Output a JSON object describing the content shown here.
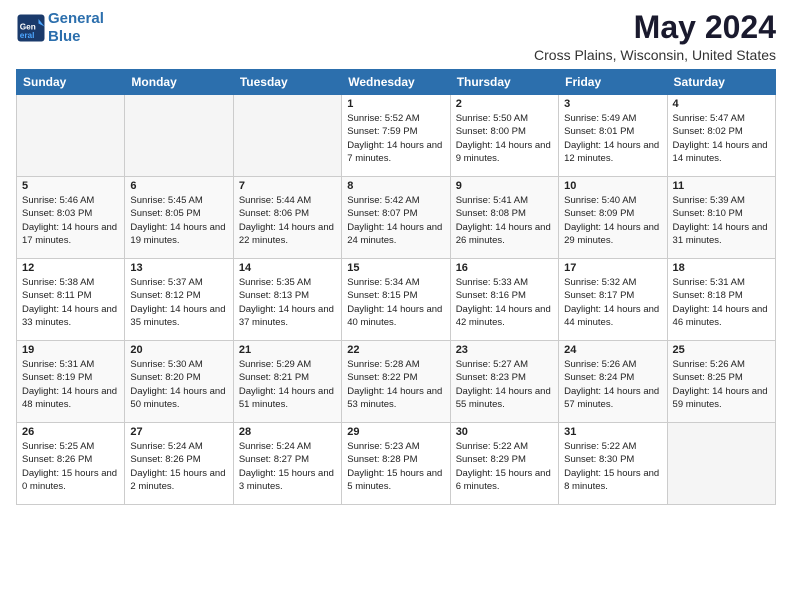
{
  "header": {
    "logo_line1": "General",
    "logo_line2": "Blue",
    "month_year": "May 2024",
    "location": "Cross Plains, Wisconsin, United States"
  },
  "weekdays": [
    "Sunday",
    "Monday",
    "Tuesday",
    "Wednesday",
    "Thursday",
    "Friday",
    "Saturday"
  ],
  "weeks": [
    [
      {
        "day": "",
        "empty": true
      },
      {
        "day": "",
        "empty": true
      },
      {
        "day": "",
        "empty": true
      },
      {
        "day": "1",
        "sunrise": "5:52 AM",
        "sunset": "7:59 PM",
        "daylight": "14 hours and 7 minutes."
      },
      {
        "day": "2",
        "sunrise": "5:50 AM",
        "sunset": "8:00 PM",
        "daylight": "14 hours and 9 minutes."
      },
      {
        "day": "3",
        "sunrise": "5:49 AM",
        "sunset": "8:01 PM",
        "daylight": "14 hours and 12 minutes."
      },
      {
        "day": "4",
        "sunrise": "5:47 AM",
        "sunset": "8:02 PM",
        "daylight": "14 hours and 14 minutes."
      }
    ],
    [
      {
        "day": "5",
        "sunrise": "5:46 AM",
        "sunset": "8:03 PM",
        "daylight": "14 hours and 17 minutes."
      },
      {
        "day": "6",
        "sunrise": "5:45 AM",
        "sunset": "8:05 PM",
        "daylight": "14 hours and 19 minutes."
      },
      {
        "day": "7",
        "sunrise": "5:44 AM",
        "sunset": "8:06 PM",
        "daylight": "14 hours and 22 minutes."
      },
      {
        "day": "8",
        "sunrise": "5:42 AM",
        "sunset": "8:07 PM",
        "daylight": "14 hours and 24 minutes."
      },
      {
        "day": "9",
        "sunrise": "5:41 AM",
        "sunset": "8:08 PM",
        "daylight": "14 hours and 26 minutes."
      },
      {
        "day": "10",
        "sunrise": "5:40 AM",
        "sunset": "8:09 PM",
        "daylight": "14 hours and 29 minutes."
      },
      {
        "day": "11",
        "sunrise": "5:39 AM",
        "sunset": "8:10 PM",
        "daylight": "14 hours and 31 minutes."
      }
    ],
    [
      {
        "day": "12",
        "sunrise": "5:38 AM",
        "sunset": "8:11 PM",
        "daylight": "14 hours and 33 minutes."
      },
      {
        "day": "13",
        "sunrise": "5:37 AM",
        "sunset": "8:12 PM",
        "daylight": "14 hours and 35 minutes."
      },
      {
        "day": "14",
        "sunrise": "5:35 AM",
        "sunset": "8:13 PM",
        "daylight": "14 hours and 37 minutes."
      },
      {
        "day": "15",
        "sunrise": "5:34 AM",
        "sunset": "8:15 PM",
        "daylight": "14 hours and 40 minutes."
      },
      {
        "day": "16",
        "sunrise": "5:33 AM",
        "sunset": "8:16 PM",
        "daylight": "14 hours and 42 minutes."
      },
      {
        "day": "17",
        "sunrise": "5:32 AM",
        "sunset": "8:17 PM",
        "daylight": "14 hours and 44 minutes."
      },
      {
        "day": "18",
        "sunrise": "5:31 AM",
        "sunset": "8:18 PM",
        "daylight": "14 hours and 46 minutes."
      }
    ],
    [
      {
        "day": "19",
        "sunrise": "5:31 AM",
        "sunset": "8:19 PM",
        "daylight": "14 hours and 48 minutes."
      },
      {
        "day": "20",
        "sunrise": "5:30 AM",
        "sunset": "8:20 PM",
        "daylight": "14 hours and 50 minutes."
      },
      {
        "day": "21",
        "sunrise": "5:29 AM",
        "sunset": "8:21 PM",
        "daylight": "14 hours and 51 minutes."
      },
      {
        "day": "22",
        "sunrise": "5:28 AM",
        "sunset": "8:22 PM",
        "daylight": "14 hours and 53 minutes."
      },
      {
        "day": "23",
        "sunrise": "5:27 AM",
        "sunset": "8:23 PM",
        "daylight": "14 hours and 55 minutes."
      },
      {
        "day": "24",
        "sunrise": "5:26 AM",
        "sunset": "8:24 PM",
        "daylight": "14 hours and 57 minutes."
      },
      {
        "day": "25",
        "sunrise": "5:26 AM",
        "sunset": "8:25 PM",
        "daylight": "14 hours and 59 minutes."
      }
    ],
    [
      {
        "day": "26",
        "sunrise": "5:25 AM",
        "sunset": "8:26 PM",
        "daylight": "15 hours and 0 minutes."
      },
      {
        "day": "27",
        "sunrise": "5:24 AM",
        "sunset": "8:26 PM",
        "daylight": "15 hours and 2 minutes."
      },
      {
        "day": "28",
        "sunrise": "5:24 AM",
        "sunset": "8:27 PM",
        "daylight": "15 hours and 3 minutes."
      },
      {
        "day": "29",
        "sunrise": "5:23 AM",
        "sunset": "8:28 PM",
        "daylight": "15 hours and 5 minutes."
      },
      {
        "day": "30",
        "sunrise": "5:22 AM",
        "sunset": "8:29 PM",
        "daylight": "15 hours and 6 minutes."
      },
      {
        "day": "31",
        "sunrise": "5:22 AM",
        "sunset": "8:30 PM",
        "daylight": "15 hours and 8 minutes."
      },
      {
        "day": "",
        "empty": true
      }
    ]
  ]
}
